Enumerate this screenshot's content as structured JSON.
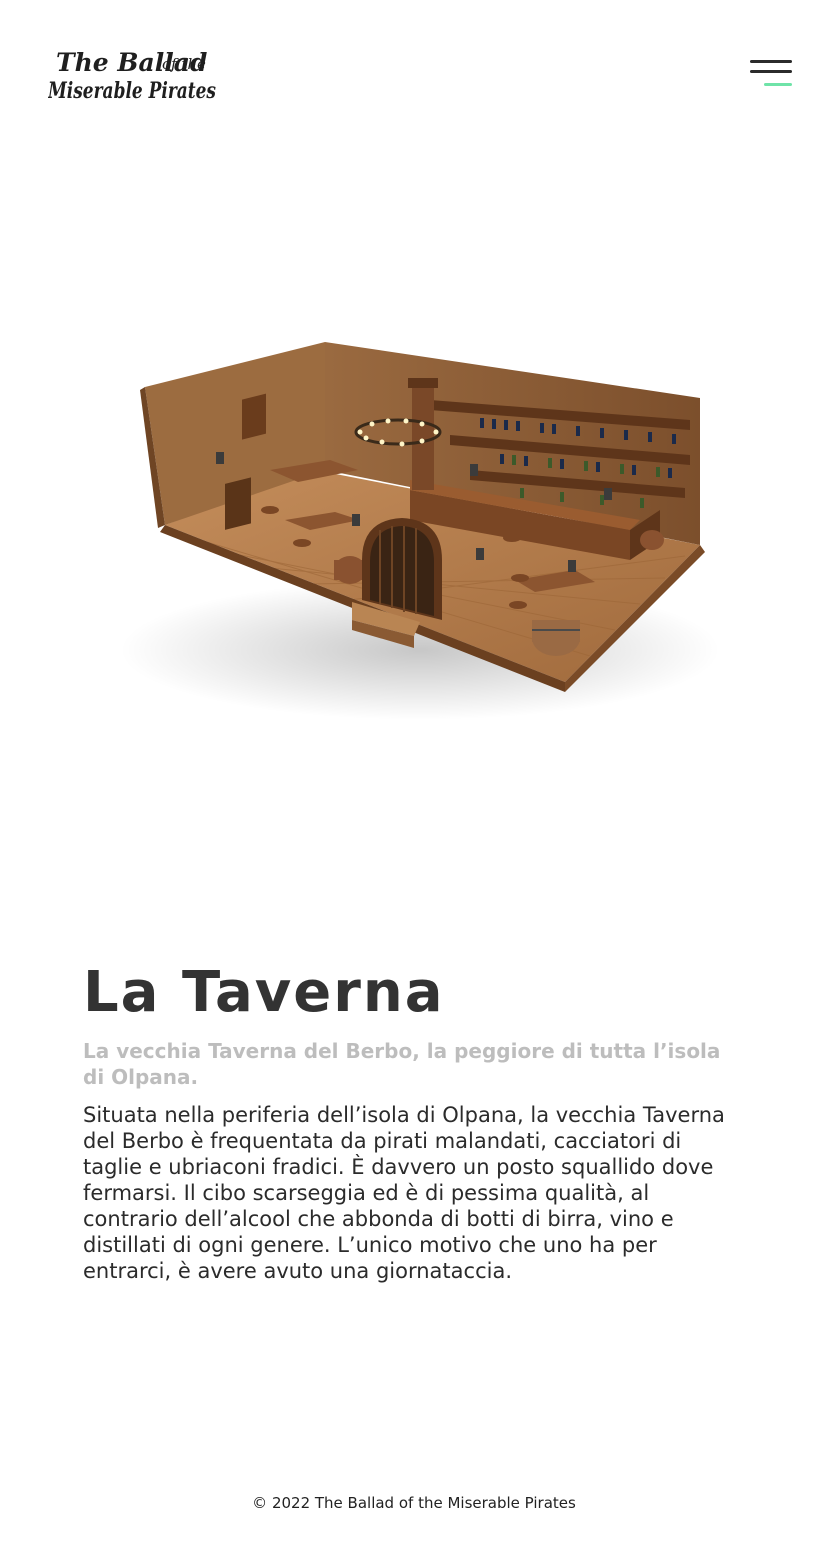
{
  "header": {
    "logo_line1": "The Ballad",
    "logo_of_the": "of the",
    "logo_line2": "Miserable Pirates",
    "menu_icon": "hamburger-menu-icon",
    "menu_accent_color": "#6fe3a8"
  },
  "hero": {
    "image_subject": "isometric tavern room"
  },
  "main": {
    "title": "La Taverna",
    "subtitle": "La vecchia Taverna del Berbo, la peggiore di tutta l’isola di Olpana.",
    "body": "Situata nella periferia dell’isola di Olpana, la vecchia Taverna del Berbo è frequentata da pirati malandati, cacciatori di taglie e ubriaconi fradici. È davvero un posto squallido dove fermarsi. Il cibo scarseggia ed è di pessima qualità, al contrario dell’alcool che abbonda di botti di birra, vino e distillati di ogni genere. L’unico motivo che uno ha per entrarci, è avere avuto una giornataccia."
  },
  "footer": {
    "copyright": "© 2022 The Ballad of the Miserable Pirates"
  },
  "colors": {
    "text": "#2b2b2b",
    "subtitle": "#bdbdbd",
    "accent": "#6fe3a8",
    "wood_dark": "#5a3418",
    "wood_mid": "#8a5a33",
    "wood_light": "#b27b4c"
  }
}
